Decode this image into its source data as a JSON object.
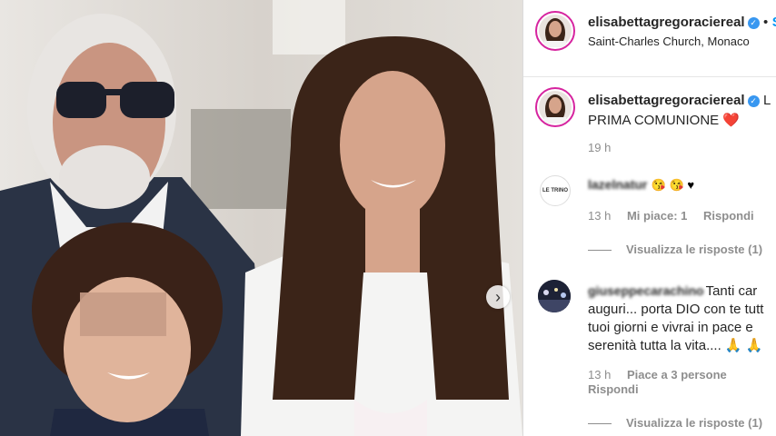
{
  "post": {
    "next_icon": "chevron-right-icon",
    "next_glyph": "›",
    "blur_color": "#c79b86"
  },
  "header": {
    "username": "elisabettagregoraciereal",
    "verified_glyph": "✓",
    "follow_label": "S",
    "location": "Saint-Charles Church, Monaco"
  },
  "caption": {
    "username": "elisabettagregoraciereal",
    "text_start": "L",
    "text_line2": "PRIMA COMUNIONE",
    "heart": "❤️",
    "time": "19 h"
  },
  "comments": [
    {
      "username": "lazelnatur",
      "avatar_text": "LE TRINO",
      "text": "😘 😘 ♥",
      "time": "13 h",
      "likes": "Mi piace: 1",
      "reply": "Rispondi",
      "view_replies": "Visualizza le risposte (1)"
    },
    {
      "username": "giuseppecarachino",
      "text_inline": "Tanti car",
      "lines": [
        "auguri... porta DIO con te tutt",
        "tuoi giorni e vivrai in pace e",
        "serenità tutta la vita.... 🙏 🙏"
      ],
      "time": "13 h",
      "likes": "Piace a 3 persone",
      "reply": "Rispondi",
      "view_replies": "Visualizza le risposte (1)"
    }
  ],
  "colors": {
    "link": "#0095f6",
    "text": "#262626",
    "muted": "#8e8e8e",
    "ring": "#d6249f"
  }
}
